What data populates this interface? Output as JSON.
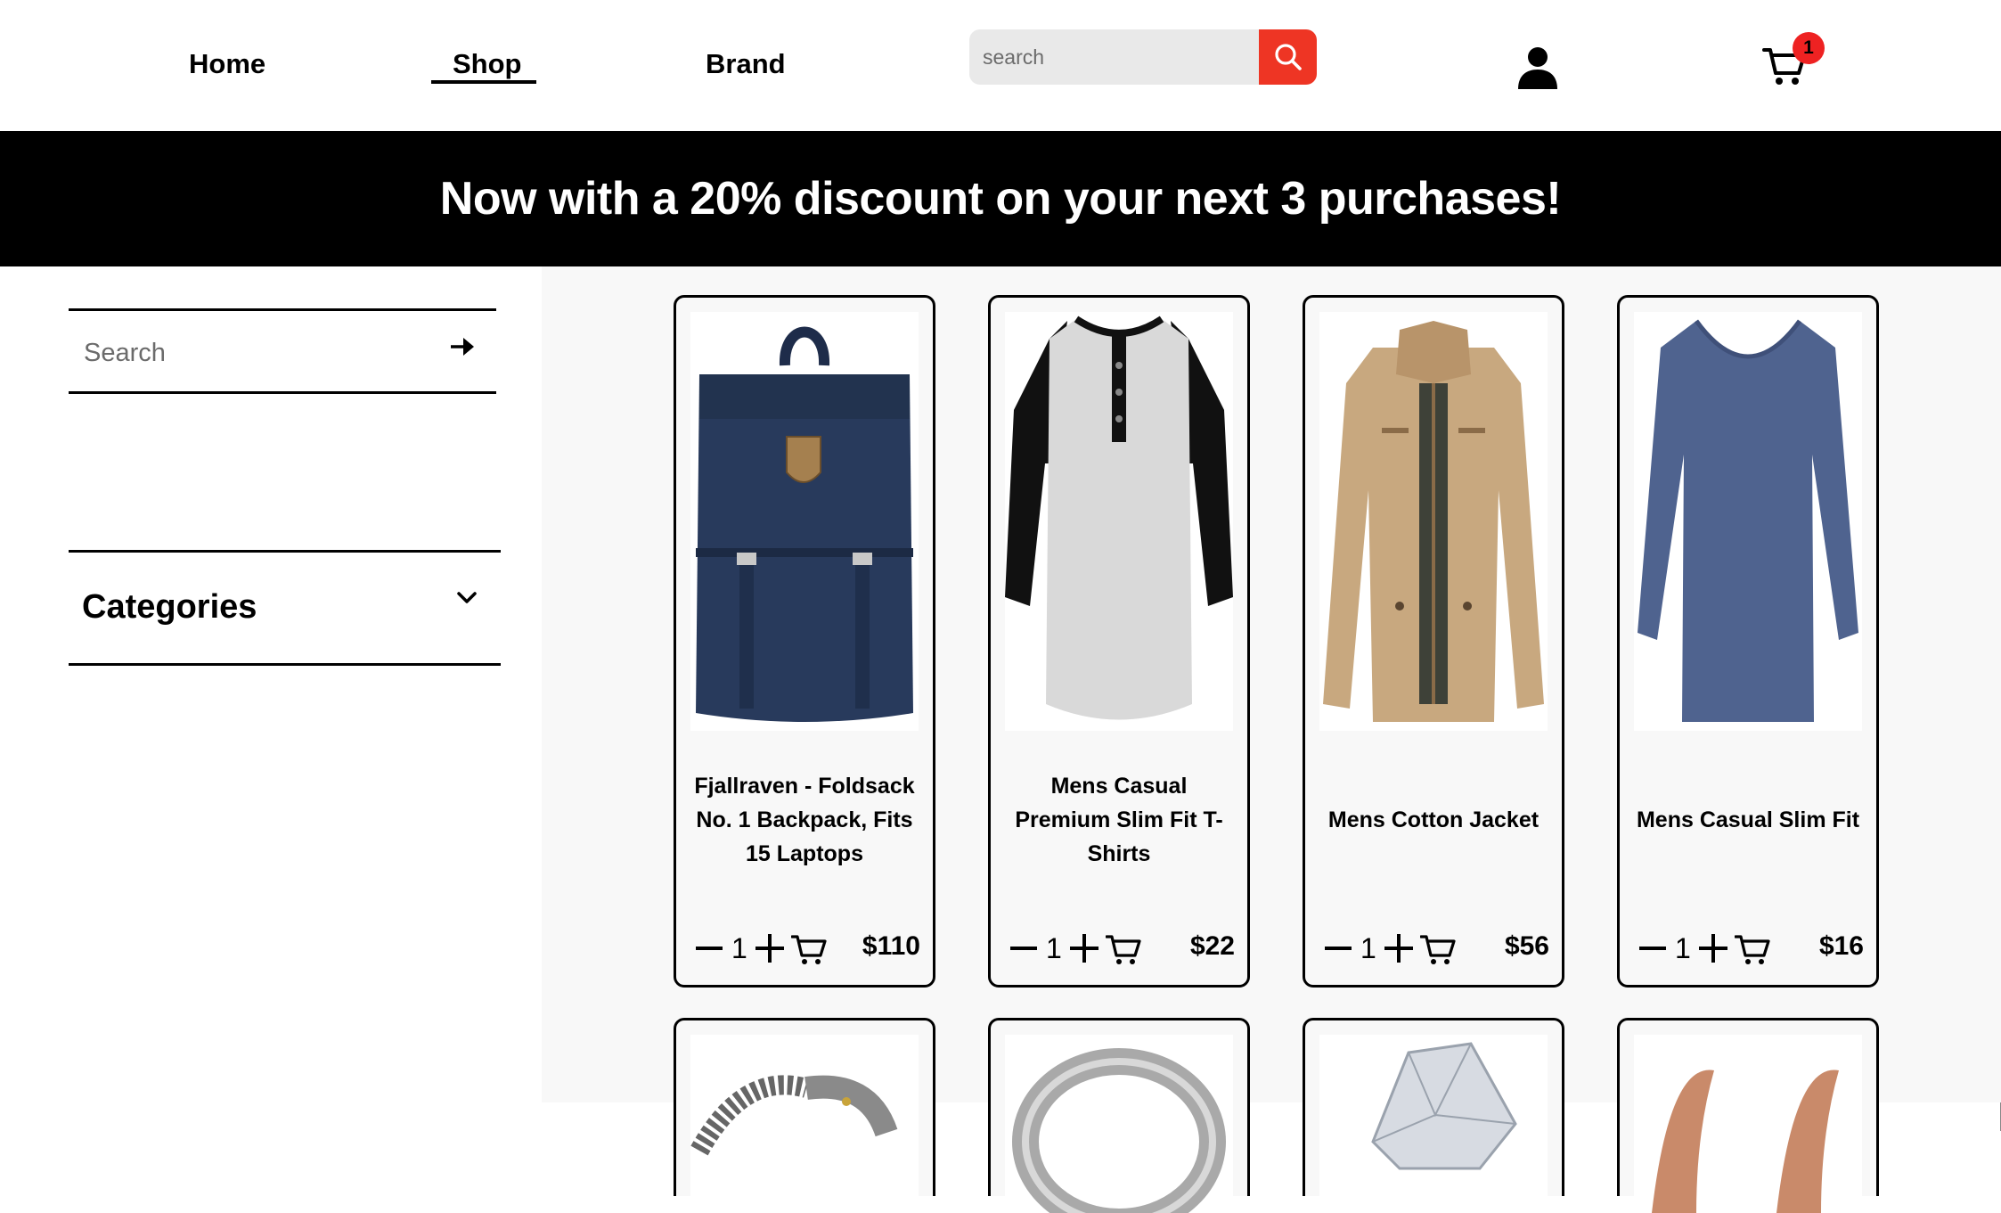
{
  "nav": {
    "home": "Home",
    "shop": "Shop",
    "brand": "Brand",
    "active": "shop"
  },
  "header_search": {
    "placeholder": "search"
  },
  "cart": {
    "count": "1"
  },
  "banner": {
    "text": "Now with a 20% discount on your next 3 purchases!"
  },
  "sidebar": {
    "search_placeholder": "Search",
    "categories_label": "Categories"
  },
  "colors": {
    "accent": "#ee3524",
    "badge": "#ee2222",
    "banner_bg": "#000000"
  },
  "products": [
    {
      "title": "Fjallraven - Foldsack No. 1 Backpack, Fits 15 Laptops",
      "qty": "1",
      "price": "$110",
      "image": "navy-backpack"
    },
    {
      "title": "Mens Casual Premium Slim Fit T-Shirts",
      "qty": "1",
      "price": "$22",
      "image": "raglan-henley-tshirt"
    },
    {
      "title": "Mens Cotton Jacket",
      "qty": "1",
      "price": "$56",
      "image": "khaki-cotton-jacket"
    },
    {
      "title": "Mens Casual Slim Fit",
      "qty": "1",
      "price": "$16",
      "image": "blue-long-sleeve-shirt"
    }
  ],
  "partial_products": [
    {
      "image": "dragon-chain-bracelet"
    },
    {
      "image": "silver-ring"
    },
    {
      "image": "diamond-ring"
    },
    {
      "image": "rose-gold-earrings"
    }
  ]
}
